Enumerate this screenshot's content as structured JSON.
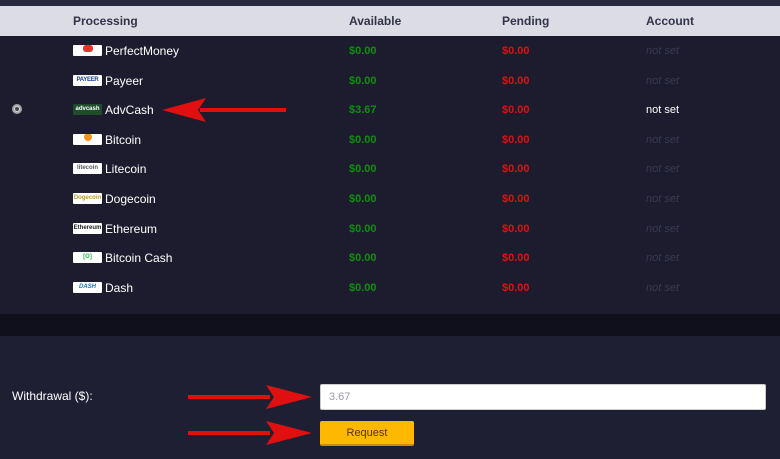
{
  "header": {
    "processing": "Processing",
    "available": "Available",
    "pending": "Pending",
    "account": "Account"
  },
  "rows": [
    {
      "name": "PerfectMoney",
      "available": "$0.00",
      "pending": "$0.00",
      "account": "not set",
      "logo": "pm"
    },
    {
      "name": "Payeer",
      "available": "$0.00",
      "pending": "$0.00",
      "account": "not set",
      "logo": "payeer",
      "logo_text": "PAYEER"
    },
    {
      "name": "AdvCash",
      "available": "$3.67",
      "pending": "$0.00",
      "account": "not set",
      "logo": "advcash",
      "logo_text": "advcash",
      "selected": true
    },
    {
      "name": "Bitcoin",
      "available": "$0.00",
      "pending": "$0.00",
      "account": "not set",
      "logo": "btc"
    },
    {
      "name": "Litecoin",
      "available": "$0.00",
      "pending": "$0.00",
      "account": "not set",
      "logo": "ltc",
      "logo_text": "litecoin"
    },
    {
      "name": "Dogecoin",
      "available": "$0.00",
      "pending": "$0.00",
      "account": "not set",
      "logo": "doge",
      "logo_text": "Dogecoin"
    },
    {
      "name": "Ethereum",
      "available": "$0.00",
      "pending": "$0.00",
      "account": "not set",
      "logo": "eth",
      "logo_text": "Ethereum"
    },
    {
      "name": "Bitcoin Cash",
      "available": "$0.00",
      "pending": "$0.00",
      "account": "not set",
      "logo": "bch",
      "logo_text": "[O]"
    },
    {
      "name": "Dash",
      "available": "$0.00",
      "pending": "$0.00",
      "account": "not set",
      "logo": "dash",
      "logo_text": "DASH"
    }
  ],
  "withdrawal": {
    "label": "Withdrawal ($):",
    "value": "3.67",
    "button": "Request"
  },
  "colors": {
    "available": "#0f8f0f",
    "pending": "#dd1111",
    "button": "#ffb800",
    "arrow": "#e01010"
  }
}
